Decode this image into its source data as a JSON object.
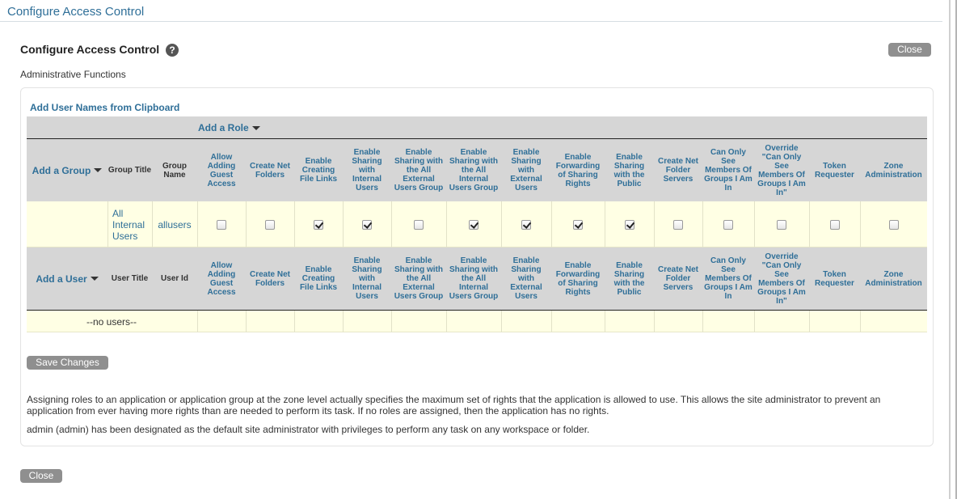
{
  "window": {
    "title": "Configure Access Control"
  },
  "page": {
    "heading": "Configure Access Control",
    "subheading": "Administrative Functions",
    "close_label": "Close",
    "add_clipboard_label": "Add User Names from Clipboard",
    "add_role_label": "Add a Role",
    "add_group_label": "Add a Group",
    "add_user_label": "Add a User",
    "save_label": "Save Changes",
    "note1": "Assigning roles to an application or application group at the zone level actually specifies the maximum set of rights that the application is allowed to use. This allows the site administrator to prevent an application from ever having more rights than are needed to perform its task. If no roles are assigned, then the application has no rights.",
    "note2": "admin (admin) has been designated as the default site administrator with privileges to perform any task on any workspace or folder."
  },
  "group_table": {
    "headers": {
      "title": "Group Title",
      "name": "Group Name"
    },
    "rows": [
      {
        "title": "All Internal Users",
        "name": "allusers",
        "rights": [
          false,
          false,
          true,
          true,
          false,
          true,
          true,
          true,
          true,
          false,
          false,
          false,
          false,
          false
        ]
      }
    ]
  },
  "user_table": {
    "headers": {
      "title": "User Title",
      "id": "User Id"
    },
    "empty_text": "--no users--"
  },
  "rights": [
    "Allow Adding Guest Access",
    "Create Net Folders",
    "Enable Creating File Links",
    "Enable Sharing with Internal Users",
    "Enable Sharing with the All External Users Group",
    "Enable Sharing with the All Internal Users Group",
    "Enable Sharing with External Users",
    "Enable Forwarding of Sharing Rights",
    "Enable Sharing with the Public",
    "Create Net Folder Servers",
    "Can Only See Members Of Groups I Am In",
    "Override \"Can Only See Members Of Groups I Am In\"",
    "Token Requester",
    "Zone Administration"
  ],
  "colors": {
    "link": "#2f6f98",
    "header_bg": "#d6d6d6",
    "row_bg": "#ffffe4",
    "button_bg": "#8f8f8f"
  }
}
